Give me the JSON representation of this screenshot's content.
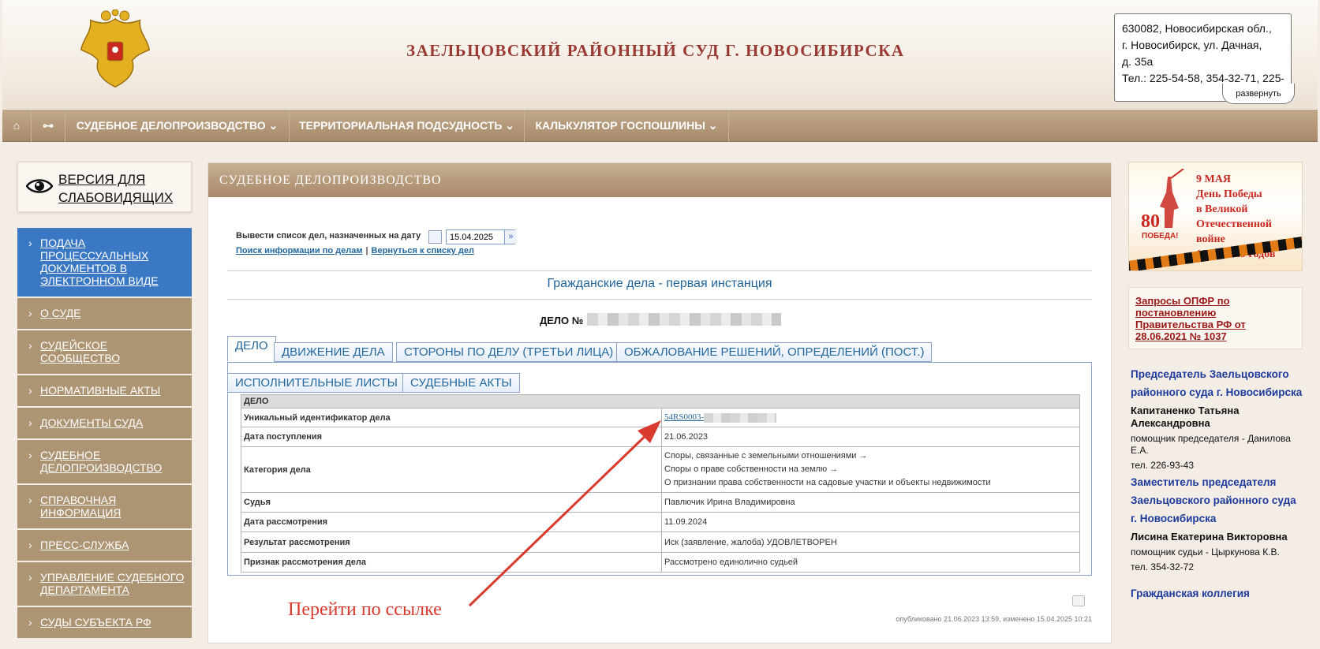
{
  "header": {
    "court_title": "ЗАЕЛЬЦОВСКИЙ РАЙОННЫЙ СУД Г. НОВОСИБИРСКА",
    "address_lines": [
      "630082, Новосибирская обл.,",
      "г. Новосибирск, ул. Дачная,",
      "д. 35а",
      "Тел.: 225-54-58, 354-32-71, 225-"
    ],
    "expand_label": "развернуть"
  },
  "nav": {
    "home_icon": "home-icon",
    "sitemap_icon": "sitemap-icon",
    "items": [
      {
        "label": "СУДЕБНОЕ ДЕЛОПРОИЗВОДСТВО ⌄"
      },
      {
        "label": "ТЕРРИТОРИАЛЬНАЯ ПОДСУДНОСТЬ ⌄"
      },
      {
        "label": "КАЛЬКУЛЯТОР ГОСПОШЛИНЫ ⌄"
      }
    ]
  },
  "sidebar": {
    "vision_label": "ВЕРСИЯ ДЛЯ\nСЛАБОВИДЯЩИХ",
    "items": [
      {
        "label": "Подача процессуальных документов в электронном виде"
      },
      {
        "label": "О суде"
      },
      {
        "label": "Судейское сообщество"
      },
      {
        "label": "Нормативные акты"
      },
      {
        "label": "Документы суда"
      },
      {
        "label": "Судебное делопроизводство"
      },
      {
        "label": "Справочная информация"
      },
      {
        "label": "Пресс-служба"
      },
      {
        "label": "Управление Судебного департамента"
      },
      {
        "label": "Суды субъекта РФ"
      }
    ]
  },
  "main": {
    "section_header": "СУДЕБНОЕ ДЕЛОПРОИЗВОДСТВО",
    "date_label": "Вывести список дел, назначенных на дату",
    "date_value": "15.04.2025",
    "search_link": "Поиск информации по делам",
    "back_link": "Вернуться к списку дел",
    "link_separator": "|",
    "case_section_title": "Гражданские дела - первая инстанция",
    "case_label": "ДЕЛО №",
    "tabs": [
      {
        "label": "Дело"
      },
      {
        "label": "Движение дела"
      },
      {
        "label": "Стороны по делу (третьи лица)"
      },
      {
        "label": "Обжалование решений, определений (пост.)"
      },
      {
        "label": "Исполнительные листы"
      },
      {
        "label": "Судебные акты"
      }
    ],
    "table": {
      "header": "ДЕЛО",
      "uid_label": "Уникальный идентификатор дела",
      "uid_value": "54RS0003-",
      "rows": [
        {
          "key": "Дата поступления",
          "value": "21.06.2023"
        },
        {
          "key": "Категория дела",
          "value": "Споры, связанные с земельными отношениями →"
        },
        {
          "key": "Судья",
          "value": "Павлючик Ирина Владимировна"
        },
        {
          "key": "Дата рассмотрения",
          "value": "11.09.2024"
        },
        {
          "key": "Результат рассмотрения",
          "value": "Иск (заявление, жалоба) УДОВЛЕТВОРЕН"
        },
        {
          "key": "Признак рассмотрения дела",
          "value": "Рассмотрено единолично судьей"
        }
      ],
      "category_line2": "Споры о праве собственности на землю →",
      "category_line3": "О признании права собственности на садовые участки и объекты недвижимости"
    },
    "published": "опубликовано 21.06.2023 13:59, изменено 15.04.2025 10:21"
  },
  "annotation": {
    "text": "Перейти по ссылке",
    "color": "#d83a2e"
  },
  "right": {
    "banner_text": "9 МАЯ\nДень Победы\nв Великой\nОтечественной войне\n1941–1945 годов",
    "banner_num": "80",
    "banner_pob": "ПОБЕДА!",
    "opfr": "Запросы ОПФР по постановлению Правительства РФ от 28.06.2021 № 1037",
    "chair_title": "Председатель Заельцовского районного суда г. Новосибирска",
    "chair_name": "Капитаненко Татьяна Александровна",
    "chair_assistant": "помощник председателя - Данилова Е.А.",
    "chair_phone": "тел. 226-93-43",
    "deputy_title": "Заместитель председателя Заельцовского районного суда г. Новосибирска",
    "deputy_name": "Лисина Екатерина Викторовна",
    "deputy_assistant": "помощник судьи - Цыркунова К.В.",
    "deputy_phone": "тел. 354-32-72",
    "civil_board": "Гражданская коллегия"
  },
  "colors": {
    "title_red": "#9b3a33",
    "nav_brown": "#a78a6a",
    "active_blue": "#3b78c4",
    "link_blue": "#23689e"
  }
}
